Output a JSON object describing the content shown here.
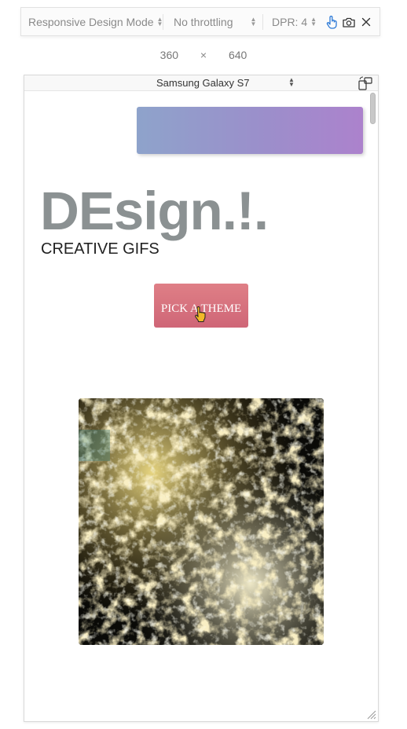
{
  "toolbar": {
    "mode_label": "Responsive Design Mode",
    "throttle_label": "No throttling",
    "dpr_label": "DPR: 4",
    "icons": [
      "touch-icon",
      "camera-icon",
      "close-icon"
    ]
  },
  "size": {
    "width": "360",
    "separator": "×",
    "height": "640"
  },
  "device": {
    "name": "Samsung Galaxy S7"
  },
  "page": {
    "title": "DEsign.!.",
    "subtitle": "CREATIVE GIFS",
    "theme_button_label": "PICK A THEME",
    "banner_gradient": [
      "#8ea3cb",
      "#ac82cc"
    ],
    "button_color": "#d8717f",
    "title_color": "#8b9192"
  }
}
